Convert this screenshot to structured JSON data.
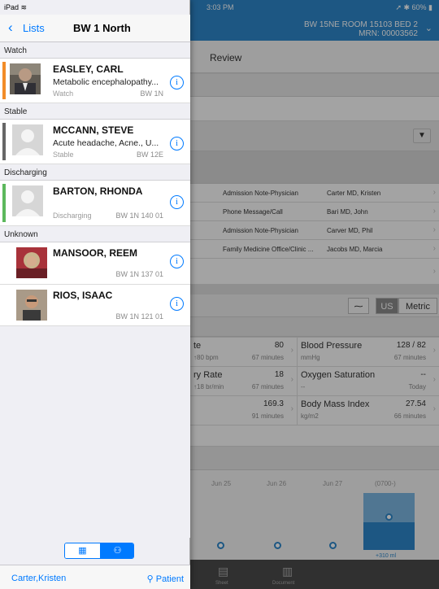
{
  "status": {
    "device": "iPad",
    "time": "3:03 PM",
    "battery": "60%"
  },
  "header": {
    "room": "BW 15NE ROOM 15103 BED 2",
    "mrn": "MRN: 00003562"
  },
  "background": {
    "review_label": "Review",
    "notes": [
      {
        "type": "Admission Note-Physician",
        "author": "Carter MD, Kristen"
      },
      {
        "type": "Phone Message/Call",
        "author": "Bari MD, John"
      },
      {
        "type": "Admission Note-Physician",
        "author": "Carver MD, Phil"
      },
      {
        "type": "Family Medicine Office/Clinic ...",
        "author": "Jacobs MD, Marcia"
      }
    ],
    "units": {
      "us": "US",
      "metric": "Metric"
    },
    "vitals": [
      {
        "name": "te",
        "value": "80",
        "sub": "↑80 bpm",
        "time": "67 minutes"
      },
      {
        "name": "Blood Pressure",
        "value": "128 / 82",
        "sub": "mmHg",
        "time": "67 minutes"
      },
      {
        "name": "ry Rate",
        "value": "18",
        "sub": "↑18 br/min",
        "time": "67 minutes"
      },
      {
        "name": "Oxygen Saturation",
        "value": "--",
        "sub": "--",
        "time": "Today"
      },
      {
        "name": "",
        "value": "169.3",
        "sub": "",
        "time": "91 minutes"
      },
      {
        "name": "Body Mass Index",
        "value": "27.54",
        "sub": "kg/m2",
        "time": "66 minutes"
      }
    ],
    "graph_labels": [
      "Jun 25",
      "Jun 26",
      "Jun 27",
      "(0700-)"
    ],
    "graph_footer": "+310 ml",
    "tabs": [
      "Sheet",
      "Document"
    ]
  },
  "panel": {
    "back_label": "Lists",
    "title": "BW 1 North",
    "sections": [
      {
        "label": "Watch"
      },
      {
        "label": "Stable"
      },
      {
        "label": "Discharging"
      },
      {
        "label": "Unknown"
      }
    ],
    "patients": [
      {
        "name": "EASLEY, CARL",
        "diagnosis": "Metabolic encephalopathy...",
        "status": "Watch",
        "location": "BW 1N"
      },
      {
        "name": "MCCANN, STEVE",
        "diagnosis": "Acute headache, Acne., U...",
        "status": "Stable",
        "location": "BW 12E"
      },
      {
        "name": "BARTON, RHONDA",
        "diagnosis": "",
        "status": "Discharging",
        "location": "BW 1N 140 01"
      },
      {
        "name": "MANSOOR, REEM",
        "diagnosis": "",
        "status": "",
        "location": "BW 1N 137 01"
      },
      {
        "name": "RIOS, ISAAC",
        "diagnosis": "",
        "status": "",
        "location": "BW 1N 121 01"
      }
    ],
    "info_glyph": "i",
    "footer_user": "Carter,Kristen",
    "footer_patient": "Patient"
  },
  "colors": {
    "accent": "#007aff",
    "watch": "#f28c28",
    "stable": "#666666",
    "discharging": "#5cb85c",
    "header_blue": "#2d86c9"
  }
}
